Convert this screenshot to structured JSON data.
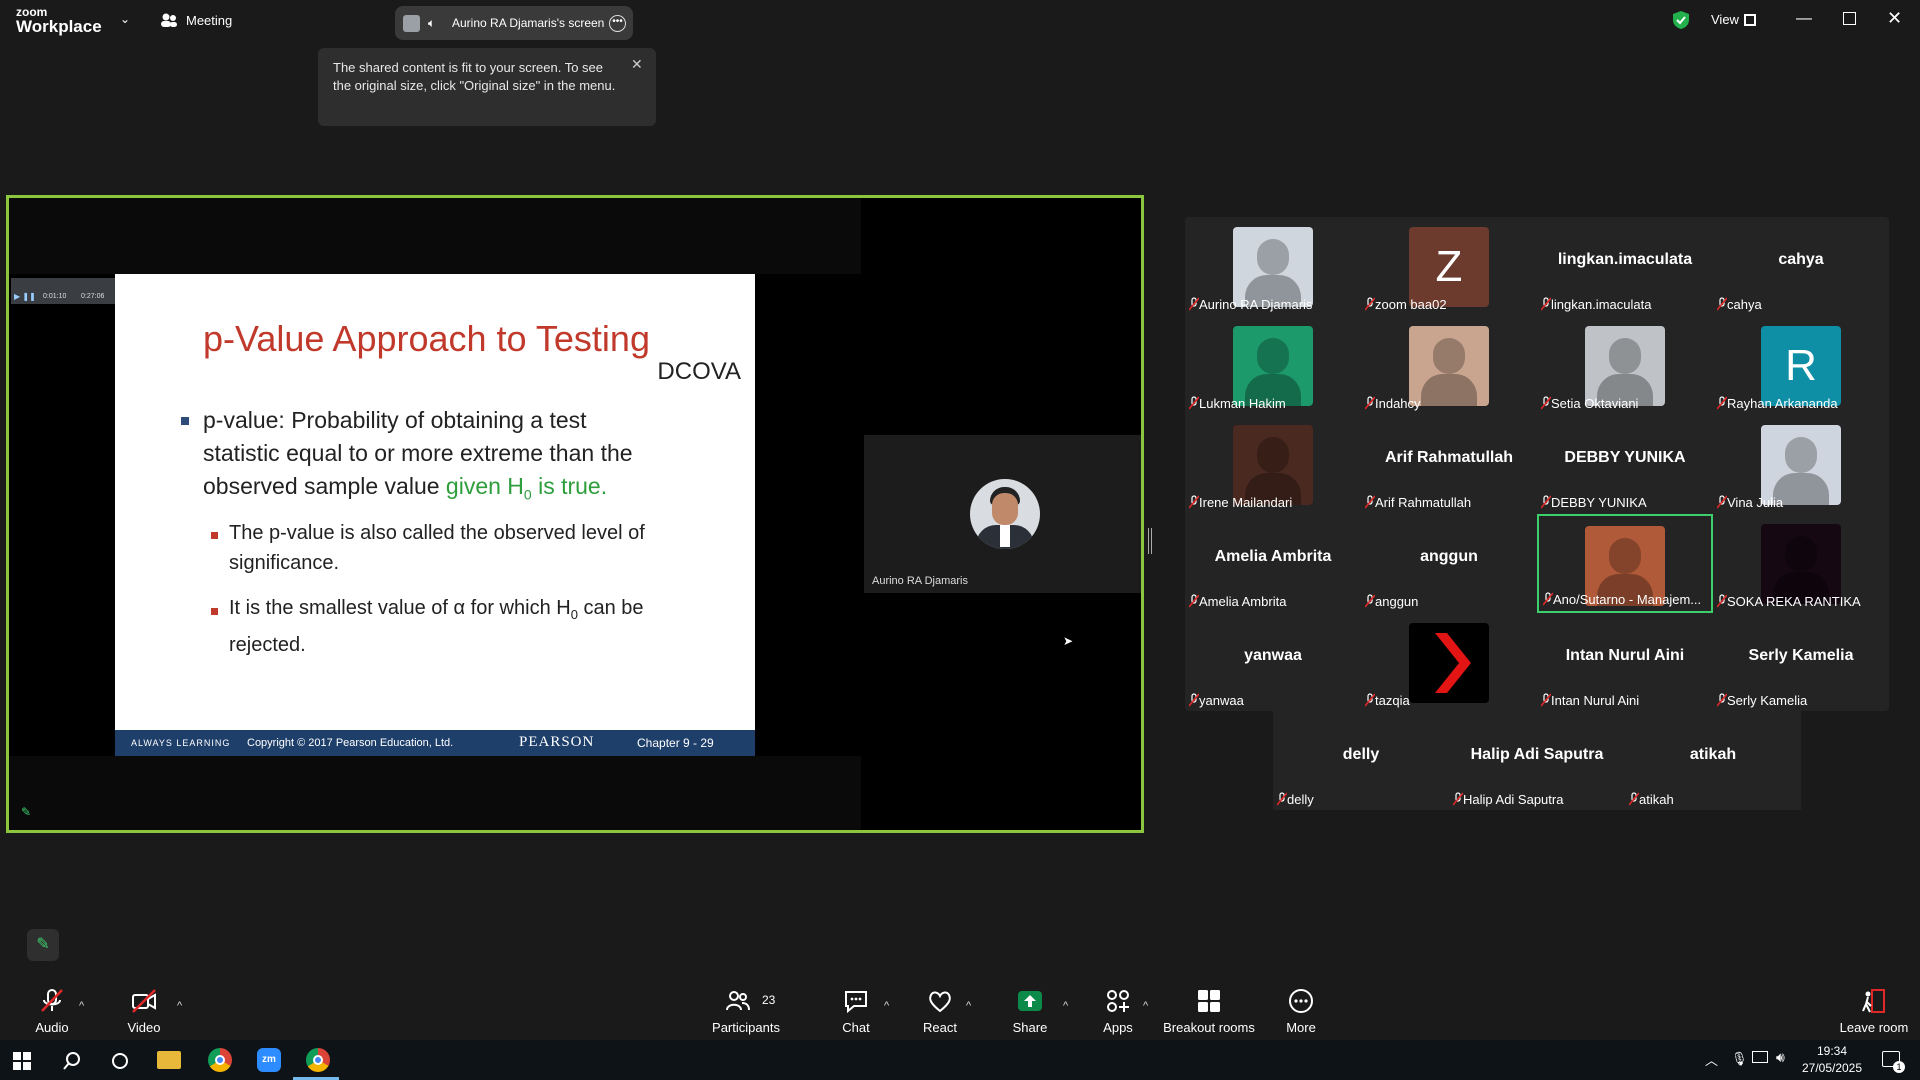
{
  "app": {
    "brand_top": "zoom",
    "brand_bottom": "Workplace",
    "meeting_label": "Meeting",
    "view_label": "View"
  },
  "share_banner": {
    "title": "Aurino RA Djamaris's screen"
  },
  "notice": {
    "text": "The shared content is fit to your screen. To see the original size, click \"Original size\" in the menu."
  },
  "slide": {
    "recorder_times": [
      "0:01:10",
      "0:27:06"
    ],
    "title": "p-Value Approach to Testing",
    "tag": "DCOVA",
    "main_line1": "p-value: Probability of obtaining a test",
    "main_line2": "statistic equal to or more extreme than the",
    "main_line3_a": "observed sample value ",
    "main_line3_b": "given H",
    "main_line3_sub": "0",
    "main_line3_c": " is true.",
    "sub1_line1": "The p-value is also called the observed level of",
    "sub1_line2": "significance.",
    "sub2_line1_a": "It is the smallest value of  α  for which H",
    "sub2_line1_sub": "0",
    "sub2_line1_b": " can be",
    "sub2_line2": "rejected.",
    "footer_left": "ALWAYS LEARNING",
    "footer_copy": "Copyright © 2017 Pearson Education, Ltd.",
    "footer_brand": "PEARSON",
    "footer_chapter": "Chapter 9 - 29"
  },
  "presenter_thumb": {
    "name": "Aurino RA Djamaris"
  },
  "participants": [
    {
      "name": "Aurino RA Djamaris",
      "display": "",
      "type": "photo",
      "color": "#cfd6de"
    },
    {
      "name": "zoom baa02",
      "display": "Z",
      "type": "letter",
      "color": "#6d3b2e"
    },
    {
      "name": "lingkan.imaculata",
      "display": "lingkan.imaculata",
      "type": "text",
      "color": ""
    },
    {
      "name": "cahya",
      "display": "cahya",
      "type": "text",
      "color": ""
    },
    {
      "name": "Lukman Hakim",
      "display": "",
      "type": "photo",
      "color": "#1d9a6c"
    },
    {
      "name": "Indahcy",
      "display": "",
      "type": "photo",
      "color": "#c9a58f"
    },
    {
      "name": "Setia Oktaviani",
      "display": "",
      "type": "photo",
      "color": "#bfc3c7"
    },
    {
      "name": "Rayhan Arkananda",
      "display": "R",
      "type": "letter",
      "color": "#0e8fa6"
    },
    {
      "name": "Irene Mailandari",
      "display": "",
      "type": "photo",
      "color": "#4a2a20"
    },
    {
      "name": "Arif Rahmatullah",
      "display": "Arif Rahmatullah",
      "type": "text",
      "color": ""
    },
    {
      "name": "DEBBY YUNIKA",
      "display": "DEBBY YUNIKA",
      "type": "text",
      "color": ""
    },
    {
      "name": "Vina Julia",
      "display": "",
      "type": "photo",
      "color": "#cfd5de"
    },
    {
      "name": "Amelia Ambrita",
      "display": "Amelia Ambrita",
      "type": "text",
      "color": ""
    },
    {
      "name": "anggun",
      "display": "anggun",
      "type": "text",
      "color": ""
    },
    {
      "name": "Ano/Sutarno - Manajem...",
      "display": "",
      "type": "photo",
      "color": "#b05a3a"
    },
    {
      "name": "SOKA REKA RANTIKA",
      "display": "",
      "type": "photo",
      "color": "#150812"
    },
    {
      "name": "yanwaa",
      "display": "yanwaa",
      "type": "text",
      "color": ""
    },
    {
      "name": "tazqia",
      "display": "",
      "type": "chevron",
      "color": "#e31414"
    },
    {
      "name": "Intan Nurul Aini",
      "display": "Intan Nurul Aini",
      "type": "text",
      "color": ""
    },
    {
      "name": "Serly Kamelia",
      "display": "Serly Kamelia",
      "type": "text",
      "color": ""
    },
    {
      "name": "delly",
      "display": "delly",
      "type": "text",
      "color": ""
    },
    {
      "name": "Halip Adi Saputra",
      "display": "Halip Adi Saputra",
      "type": "text",
      "color": ""
    },
    {
      "name": "atikah",
      "display": "atikah",
      "type": "text",
      "color": ""
    }
  ],
  "toolbar": {
    "audio": "Audio",
    "video": "Video",
    "participants": "Participants",
    "participants_count": "23",
    "chat": "Chat",
    "react": "React",
    "share": "Share",
    "apps": "Apps",
    "breakout": "Breakout rooms",
    "more": "More",
    "leave": "Leave room"
  },
  "taskbar": {
    "time": "19:34",
    "date": "27/05/2025",
    "notif_count": "1"
  },
  "colors": {
    "active_speaker": "#3ecf6d",
    "share_border": "#8cc63f",
    "share_button": "#0b8a4a"
  }
}
